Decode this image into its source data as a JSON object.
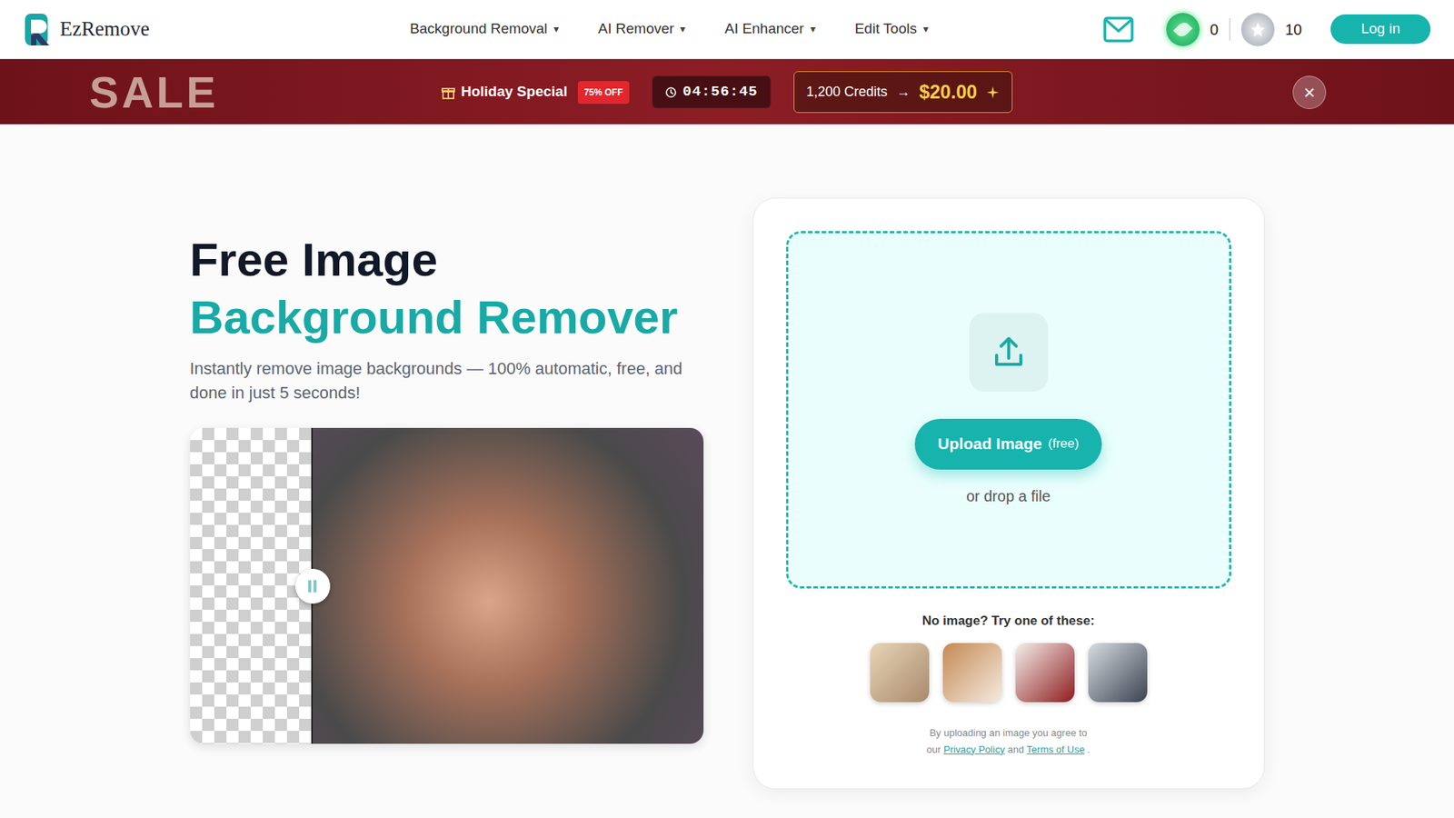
{
  "header": {
    "logo": "EzRemove",
    "nav": [
      {
        "label": "Background Removal",
        "caret": "▾"
      },
      {
        "label": "AI Remover",
        "caret": "▾"
      },
      {
        "label": "AI Enhancer",
        "caret": "▾"
      },
      {
        "label": "Edit Tools",
        "caret": "▾"
      }
    ],
    "gems": "0",
    "stars": "10",
    "login": "Log in"
  },
  "banner": {
    "sale": "SALE",
    "title": "Holiday Special",
    "badge": "75% OFF",
    "timer": "04:56:45",
    "credits": "1,200 Credits",
    "arrow": "→",
    "price": "$20.00",
    "close": "×"
  },
  "hero": {
    "title_line1": "Free Image",
    "title_line2": "Background Remover",
    "subtitle": "Instantly remove image backgrounds — 100% automatic, free, and done in just 5 seconds!"
  },
  "upload": {
    "button": "Upload Image",
    "button_note": "(free)",
    "drop": "or drop a file",
    "samples_title": "No image? Try one of these:",
    "consent": {
      "line1": "By uploading an image you agree to",
      "our": "our",
      "privacy": "Privacy Policy",
      "and": "and",
      "terms": "Terms of Use",
      "end": "."
    }
  }
}
